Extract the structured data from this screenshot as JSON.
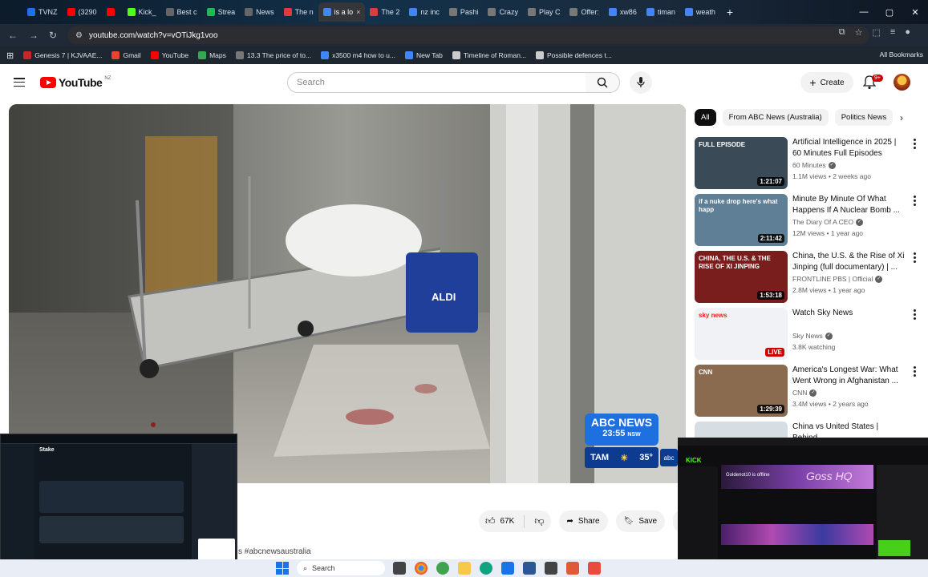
{
  "browser": {
    "tabs": [
      {
        "label": "TVNZ",
        "color": "#1a73e8",
        "active": false
      },
      {
        "label": "(3290",
        "color": "#ff0000",
        "active": false
      },
      {
        "label": "",
        "color": "#ff0000",
        "active": false
      },
      {
        "label": "Kick_",
        "color": "#53fc18",
        "active": false
      },
      {
        "label": "Best c",
        "color": "#666666",
        "active": false
      },
      {
        "label": "Strea",
        "color": "#1db954",
        "active": false
      },
      {
        "label": "News",
        "color": "#666666",
        "active": false
      },
      {
        "label": "The n",
        "color": "#e03b3b",
        "active": false
      },
      {
        "label": "is a lo",
        "color": "#4285f4",
        "active": true
      },
      {
        "label": "The 2",
        "color": "#e03b3b",
        "active": false
      },
      {
        "label": "nz inc",
        "color": "#4285f4",
        "active": false
      },
      {
        "label": "Pashi",
        "color": "#777777",
        "active": false
      },
      {
        "label": "Crazy",
        "color": "#777777",
        "active": false
      },
      {
        "label": "Play C",
        "color": "#777777",
        "active": false
      },
      {
        "label": "Offer:",
        "color": "#777777",
        "active": false
      },
      {
        "label": "xw86",
        "color": "#4285f4",
        "active": false
      },
      {
        "label": "timan",
        "color": "#4285f4",
        "active": false
      },
      {
        "label": "weath",
        "color": "#4285f4",
        "active": false
      }
    ],
    "new_tab": "+",
    "url": "youtube.com/watch?v=vOTiJkg1voo",
    "bookmarks": [
      {
        "label": "Genesis 7 | KJVAAE...",
        "color": "#c62828"
      },
      {
        "label": "Gmail",
        "color": "#ea4335"
      },
      {
        "label": "YouTube",
        "color": "#ff0000"
      },
      {
        "label": "Maps",
        "color": "#34a853"
      },
      {
        "label": "13.3 The price of to...",
        "color": "#777777"
      },
      {
        "label": "x3500 m4 how to u...",
        "color": "#4285f4"
      },
      {
        "label": "New Tab",
        "color": "#4285f4"
      },
      {
        "label": "Timeline of Roman...",
        "color": "#cccccc"
      },
      {
        "label": "Possible defences t...",
        "color": "#cccccc"
      }
    ],
    "all_bookmarks": "All Bookmarks"
  },
  "youtube": {
    "logo_text": "YouTube",
    "region": "NZ",
    "search_placeholder": "Search",
    "create_label": "Create",
    "notif_badge": "9+"
  },
  "player": {
    "abc_title": "ABC NEWS",
    "abc_time": "23:55",
    "abc_zone": "NSW",
    "weather_city": "TAM",
    "weather_temp": "35°"
  },
  "actions": {
    "likes": "67K",
    "share": "Share",
    "save": "Save",
    "more": "…"
  },
  "description_snippet": "s #abcnewsaustralia",
  "chips": [
    {
      "label": "All",
      "selected": true
    },
    {
      "label": "From ABC News (Australia)",
      "selected": false
    },
    {
      "label": "Politics News",
      "selected": false
    }
  ],
  "recommendations": [
    {
      "title": "Artificial Intelligence in 2025 | 60 Minutes Full Episodes",
      "channel": "60 Minutes",
      "meta": "1.1M views • 2 weeks ago",
      "duration": "1:21:07",
      "overlay": "FULL EPISODE",
      "thumb_bg": "#3b4a57"
    },
    {
      "title": "Minute By Minute Of What Happens If A Nuclear Bomb ...",
      "channel": "The Diary Of A CEO",
      "meta": "12M views • 1 year ago",
      "duration": "2:11:42",
      "overlay": "if a nuke drop here's what happ",
      "thumb_bg": "#5f7f96"
    },
    {
      "title": "China, the U.S. & the Rise of Xi Jinping (full documentary) | ...",
      "channel": "FRONTLINE PBS | Official",
      "meta": "2.8M views • 1 year ago",
      "duration": "1:53:18",
      "overlay": "CHINA, THE U.S. & THE RISE OF XI JINPING",
      "thumb_bg": "#7a1d1d"
    },
    {
      "title": "Watch Sky News",
      "channel": "Sky News",
      "meta": "3.8K watching",
      "duration": "LIVE",
      "overlay": "sky news",
      "thumb_bg": "#f0f2f5"
    },
    {
      "title": "America's Longest War: What Went Wrong in Afghanistan ...",
      "channel": "CNN",
      "meta": "3.4M views • 2 years ago",
      "duration": "1:29:39",
      "overlay": "CNN",
      "thumb_bg": "#8a6b4f"
    },
    {
      "title": "China vs United States | Behind",
      "channel": "",
      "meta": "",
      "duration": "",
      "overlay": "",
      "thumb_bg": "#d6dde3"
    }
  ],
  "overlays": {
    "left_brand": "Stake",
    "right_brand": "KICK",
    "right_status": "Goldenot10 is offline",
    "right_banner": "Goss HQ"
  },
  "taskbar": {
    "search_label": "Search"
  }
}
